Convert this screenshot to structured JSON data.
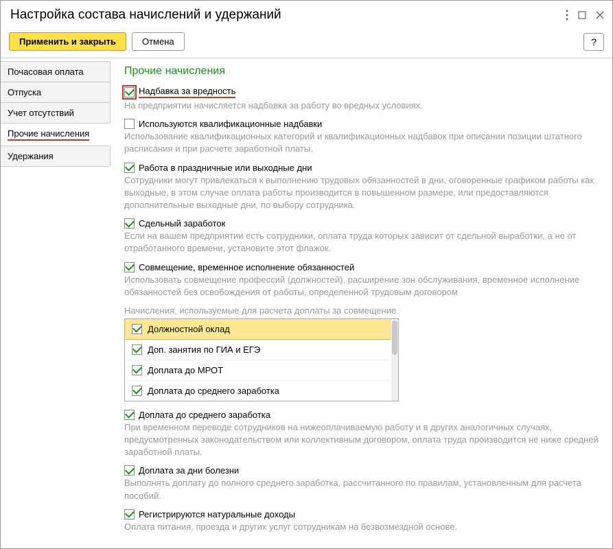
{
  "title": "Настройка состава начислений и удержаний",
  "toolbar": {
    "apply_close": "Применить и закрыть",
    "cancel": "Отмена",
    "help": "?"
  },
  "sidebar": {
    "items": [
      {
        "label": "Почасовая оплата"
      },
      {
        "label": "Отпуска"
      },
      {
        "label": "Учет отсутствий"
      },
      {
        "label": "Прочие начисления"
      },
      {
        "label": "Удержания"
      }
    ]
  },
  "content": {
    "heading": "Прочие начисления",
    "opt_hazard": {
      "checked": true,
      "label": "Надбавка за вредность",
      "desc": "На предприятии начисляется надбавка за работу во вредных условиях."
    },
    "opt_qualification": {
      "checked": false,
      "label": "Используются квалификационные надбавки",
      "desc": "Использование квалификационных категорий и квалификационных надбавок при описании позиции штатного расписания и при расчете заработной платы."
    },
    "opt_holidays": {
      "checked": true,
      "label": "Работа в праздничные или выходные дни",
      "desc": "Сотрудники могут привлекаться к выполнению трудовых обязанностей в дни, оговоренные графиком работы как выходные, в этом случае оплата работы производится в повышенном размере, или предоставляются дополнительные выходные дни, по выбору сотрудника."
    },
    "opt_piecework": {
      "checked": true,
      "label": "Сдельный заработок",
      "desc": "Если на вашем предприятии есть сотрудники, оплата труда которых зависит от сдельной выработки, а не от отработанного времени, установите этот флажок."
    },
    "opt_combination": {
      "checked": true,
      "label": "Совмещение, временное исполнение обязанностей",
      "desc": "Использовать совмещение профессий (должностей), расширение зон обслуживания, временное исполнение обязанностей без освобождения от работы, определенной трудовым договором"
    },
    "list_caption": "Начисления, используемые для расчета доплаты за совмещение",
    "list_items": [
      {
        "checked": true,
        "label": "Должностной оклад"
      },
      {
        "checked": true,
        "label": "Доп. занятия по ГИА и ЕГЭ"
      },
      {
        "checked": true,
        "label": "Доплата до МРОТ"
      },
      {
        "checked": true,
        "label": "Доплата до среднего заработка"
      }
    ],
    "opt_avg_pay": {
      "checked": true,
      "label": "Доплата до среднего заработка",
      "desc": "При временном переводе сотрудников на нижеоплачиваемую работу и в других аналогичных случаях, предусмотренных законодательством или коллективным договором, оплата труда производится не ниже средней заработной платы."
    },
    "opt_sick": {
      "checked": true,
      "label": "Доплата за дни болезни",
      "desc": "Выполнять доплату до полного среднего заработка, рассчитанного по правилам, установленным для расчета пособий."
    },
    "opt_natural": {
      "checked": true,
      "label": "Регистрируются натуральные доходы",
      "desc": "Оплата питания, проезда и других услуг сотрудникам на безвозмездной основе."
    }
  }
}
